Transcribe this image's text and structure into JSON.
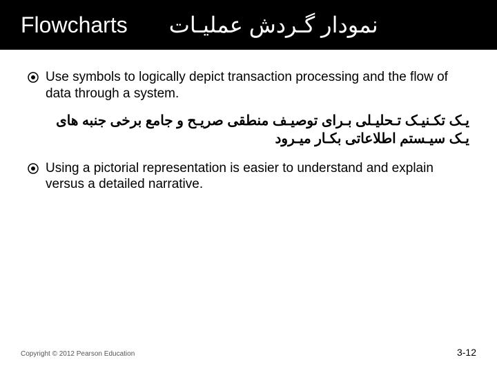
{
  "title": {
    "en": "Flowcharts",
    "fa": "نمودار گـردش عملیـات"
  },
  "bullets": [
    {
      "en": "Use symbols to logically depict transaction processing and the flow of data through a system.",
      "fa": "یـک تکـنیـک تـحلیـلی بـرای توصیـف منطقی صریـح و جامع برخی جنبه های یـک سیـستم اطلاعاتی بکـار میـرود"
    },
    {
      "en": "Using a pictorial representation is easier to understand and explain versus a detailed narrative.",
      "fa": ""
    }
  ],
  "footer": {
    "copyright": "Copyright © 2012 Pearson Education",
    "page": "3-12"
  }
}
